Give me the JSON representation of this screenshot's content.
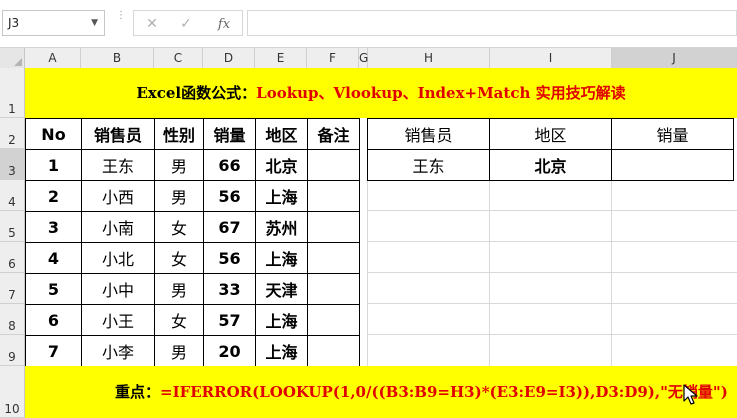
{
  "namebox": {
    "value": "J3"
  },
  "formula_bar": {
    "cancel_icon": "✕",
    "enter_icon": "✓",
    "fx_label": "fx",
    "value": ""
  },
  "columns": [
    "A",
    "B",
    "C",
    "D",
    "E",
    "F",
    "G",
    "H",
    "I",
    "J"
  ],
  "rows": [
    "1",
    "2",
    "3",
    "4",
    "5",
    "6",
    "7",
    "8",
    "9",
    "10"
  ],
  "title": {
    "prefix": "Excel函数公式：",
    "highlight": "Lookup、Vlookup、Index+Match 实用技巧解读"
  },
  "table": {
    "headers": [
      "No",
      "销售员",
      "性别",
      "销量",
      "地区",
      "备注"
    ],
    "rows": [
      [
        "1",
        "王东",
        "男",
        "66",
        "北京",
        ""
      ],
      [
        "2",
        "小西",
        "男",
        "56",
        "上海",
        ""
      ],
      [
        "3",
        "小南",
        "女",
        "67",
        "苏州",
        ""
      ],
      [
        "4",
        "小北",
        "女",
        "56",
        "上海",
        ""
      ],
      [
        "5",
        "小中",
        "男",
        "33",
        "天津",
        ""
      ],
      [
        "6",
        "小王",
        "女",
        "57",
        "上海",
        ""
      ],
      [
        "7",
        "小李",
        "男",
        "20",
        "上海",
        ""
      ]
    ]
  },
  "lookup": {
    "headers": [
      "销售员",
      "地区",
      "销量"
    ],
    "row": [
      "王东",
      "北京",
      ""
    ]
  },
  "note": {
    "label": "重点：",
    "formula": "=IFERROR(LOOKUP(1,0/((B3:B9=H3)*(E3:E9=I3)),D3:D9),\"无销量\")"
  },
  "colors": {
    "banner": "#ffff00",
    "highlight_text": "#e00000",
    "selected_header": "#d2d2d2"
  }
}
